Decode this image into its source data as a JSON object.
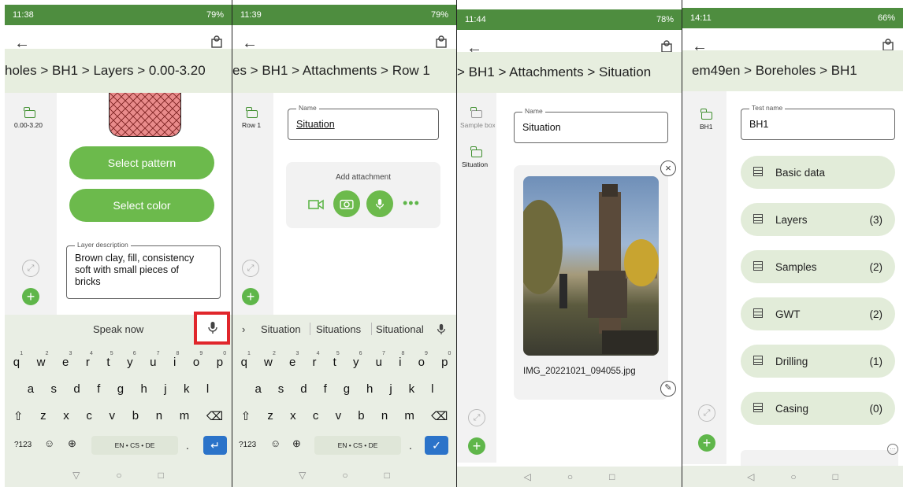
{
  "screen1": {
    "status_time": "11:38",
    "status_right": "79%",
    "breadcrumb": "holes > BH1 > Layers > 0.00-3.20",
    "folder_label": "0.00-3.20",
    "select_pattern": "Select pattern",
    "select_color": "Select color",
    "description_legend": "Layer description",
    "description_value": "Brown clay, fill, consistency soft with small pieces of bricks",
    "speak_now": "Speak now",
    "keyboard": {
      "row1": [
        "q",
        "w",
        "e",
        "r",
        "t",
        "y",
        "u",
        "i",
        "o",
        "p"
      ],
      "row1_hints": [
        "1",
        "2",
        "3",
        "4",
        "5",
        "6",
        "7",
        "8",
        "9",
        "0"
      ],
      "row2": [
        "a",
        "s",
        "d",
        "f",
        "g",
        "h",
        "j",
        "k",
        "l"
      ],
      "row3": [
        "z",
        "x",
        "c",
        "v",
        "b",
        "n",
        "m"
      ],
      "num_key": "?123",
      "lang": "EN • CS • DE",
      "period": "."
    }
  },
  "screen2": {
    "status_time": "11:39",
    "status_right": "79%",
    "breadcrumb": "es > BH1 > Attachments > Row 1",
    "folder_label": "Row 1",
    "name_legend": "Name",
    "name_value": "Situation",
    "add_attachment": "Add attachment",
    "suggestions": [
      "Situation",
      "Situations",
      "Situational"
    ],
    "keyboard": {
      "row1": [
        "q",
        "w",
        "e",
        "r",
        "t",
        "y",
        "u",
        "i",
        "o",
        "p"
      ],
      "row1_hints": [
        "1",
        "2",
        "3",
        "4",
        "5",
        "6",
        "7",
        "8",
        "9",
        "0"
      ],
      "row2": [
        "a",
        "s",
        "d",
        "f",
        "g",
        "h",
        "j",
        "k",
        "l"
      ],
      "row3": [
        "z",
        "x",
        "c",
        "v",
        "b",
        "n",
        "m"
      ],
      "num_key": "?123",
      "lang": "EN • CS • DE",
      "period": "."
    }
  },
  "screen3": {
    "status_time": "11:44",
    "status_right": "78%",
    "breadcrumb": "> BH1 > Attachments > Situation",
    "folder1_label": "Sample box",
    "folder2_label": "Situation",
    "name_legend": "Name",
    "name_value": "Situation",
    "photo_filename": "IMG_20221021_094055.jpg"
  },
  "screen4": {
    "status_time": "14:11",
    "status_right": "66%",
    "breadcrumb": "em49en > Boreholes > BH1",
    "folder_label": "BH1",
    "test_name_legend": "Test name",
    "test_name_value": "BH1",
    "sections": [
      {
        "label": "Basic data",
        "count": ""
      },
      {
        "label": "Layers",
        "count": "(3)"
      },
      {
        "label": "Samples",
        "count": "(2)"
      },
      {
        "label": "GWT",
        "count": "(2)"
      },
      {
        "label": "Drilling",
        "count": "(1)"
      },
      {
        "label": "Casing",
        "count": "(0)"
      }
    ]
  },
  "colors": {
    "status_green": "#4e8d3f",
    "accent_green": "#6cba4c",
    "breadcrumb_bg": "#e7eedf",
    "highlight_red": "#e0262b"
  },
  "icons": [
    "back-arrow-icon",
    "borehole-map-icon",
    "folder-icon",
    "expand-icon",
    "plus-icon",
    "mic-icon",
    "video-icon",
    "camera-icon",
    "more-icon",
    "close-icon",
    "edit-icon",
    "table-icon",
    "backspace-icon",
    "enter-icon",
    "check-icon",
    "shift-icon",
    "globe-icon",
    "emoji-icon"
  ]
}
